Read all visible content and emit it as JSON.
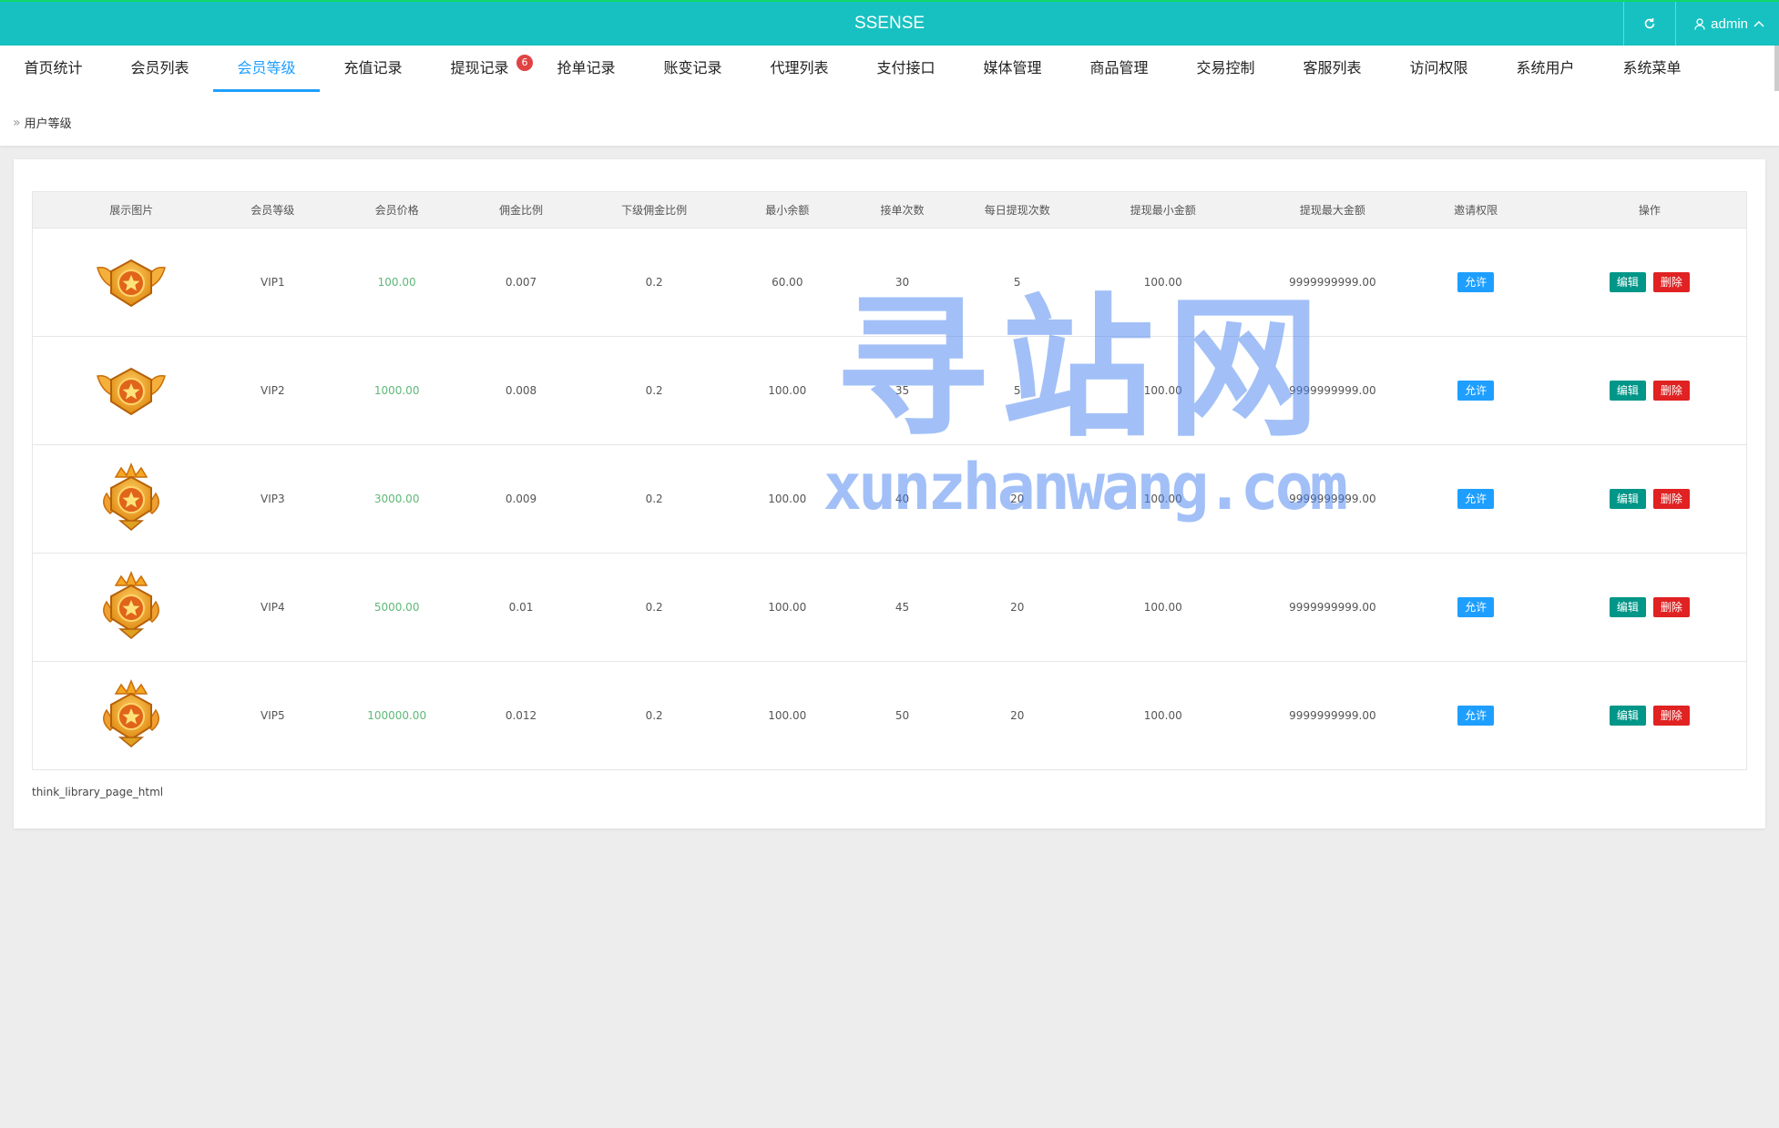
{
  "app": {
    "title": "SSENSE",
    "user": "admin"
  },
  "menu": [
    {
      "label": "首页统计",
      "active": false
    },
    {
      "label": "会员列表",
      "active": false
    },
    {
      "label": "会员等级",
      "active": true
    },
    {
      "label": "充值记录",
      "active": false
    },
    {
      "label": "提现记录",
      "active": false,
      "badge": "6"
    },
    {
      "label": "抢单记录",
      "active": false
    },
    {
      "label": "账变记录",
      "active": false
    },
    {
      "label": "代理列表",
      "active": false
    },
    {
      "label": "支付接口",
      "active": false
    },
    {
      "label": "媒体管理",
      "active": false
    },
    {
      "label": "商品管理",
      "active": false
    },
    {
      "label": "交易控制",
      "active": false
    },
    {
      "label": "客服列表",
      "active": false
    },
    {
      "label": "访问权限",
      "active": false
    },
    {
      "label": "系统用户",
      "active": false
    },
    {
      "label": "系统菜单",
      "active": false
    }
  ],
  "breadcrumb": {
    "current": "用户等级"
  },
  "table": {
    "headers": [
      "展示图片",
      "会员等级",
      "会员价格",
      "佣金比例",
      "下级佣金比例",
      "最小余额",
      "接单次数",
      "每日提现次数",
      "提现最小金额",
      "提现最大金额",
      "邀请权限",
      "操作"
    ],
    "rows": [
      {
        "level": "VIP1",
        "price": "100.00",
        "commission": "0.007",
        "sub_commission": "0.2",
        "min_balance": "60.00",
        "orders": "30",
        "daily_withdraw": "5",
        "withdraw_min": "100.00",
        "withdraw_max": "9999999999.00",
        "invite": "允许",
        "medal": "winged"
      },
      {
        "level": "VIP2",
        "price": "1000.00",
        "commission": "0.008",
        "sub_commission": "0.2",
        "min_balance": "100.00",
        "orders": "35",
        "daily_withdraw": "5",
        "withdraw_min": "100.00",
        "withdraw_max": "9999999999.00",
        "invite": "允许",
        "medal": "winged"
      },
      {
        "level": "VIP3",
        "price": "3000.00",
        "commission": "0.009",
        "sub_commission": "0.2",
        "min_balance": "100.00",
        "orders": "40",
        "daily_withdraw": "20",
        "withdraw_min": "100.00",
        "withdraw_max": "9999999999.00",
        "invite": "允许",
        "medal": "crowned"
      },
      {
        "level": "VIP4",
        "price": "5000.00",
        "commission": "0.01",
        "sub_commission": "0.2",
        "min_balance": "100.00",
        "orders": "45",
        "daily_withdraw": "20",
        "withdraw_min": "100.00",
        "withdraw_max": "9999999999.00",
        "invite": "允许",
        "medal": "crowned"
      },
      {
        "level": "VIP5",
        "price": "100000.00",
        "commission": "0.012",
        "sub_commission": "0.2",
        "min_balance": "100.00",
        "orders": "50",
        "daily_withdraw": "20",
        "withdraw_min": "100.00",
        "withdraw_max": "9999999999.00",
        "invite": "允许",
        "medal": "crowned"
      }
    ],
    "edit_label": "编辑",
    "delete_label": "删除"
  },
  "footer_text": "think_library_page_html",
  "watermark": {
    "cn": "寻站网",
    "en": "xunzhanwang.com"
  },
  "colors": {
    "topbar": "#17c1c1",
    "accent": "#1e9fff",
    "price": "#5fb878",
    "edit": "#009688",
    "delete": "#e02222",
    "badge": "#e04343"
  }
}
